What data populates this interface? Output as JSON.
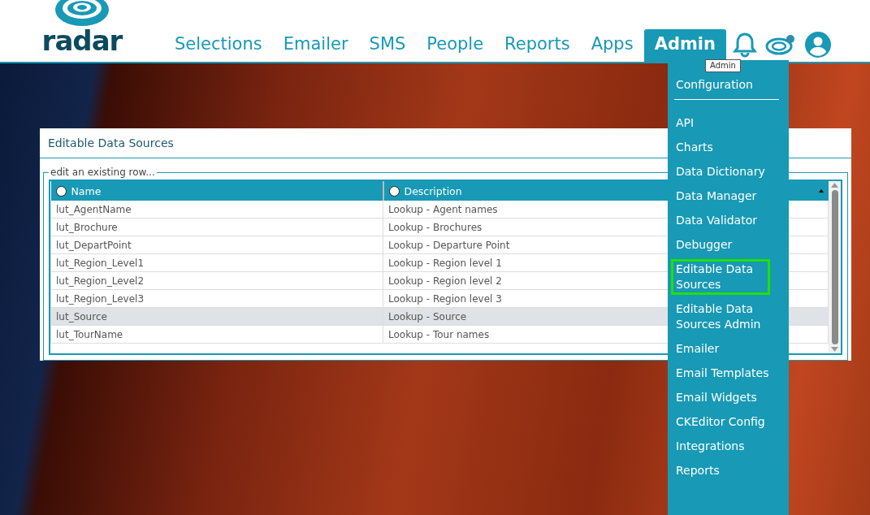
{
  "logo": {
    "text": "radar"
  },
  "nav": [
    {
      "label": "Selections",
      "selected": false
    },
    {
      "label": "Emailer",
      "selected": false
    },
    {
      "label": "SMS",
      "selected": false
    },
    {
      "label": "People",
      "selected": false
    },
    {
      "label": "Reports",
      "selected": false
    },
    {
      "label": "Apps",
      "selected": false
    },
    {
      "label": "Admin",
      "selected": true
    }
  ],
  "tooltip": "Admin",
  "panel": {
    "title": "Editable Data Sources",
    "legend": "edit an existing row...",
    "columns": [
      "Name",
      "Description"
    ],
    "rows": [
      {
        "cells": [
          "lut_AgentName",
          "Lookup - Agent names"
        ],
        "selected": false
      },
      {
        "cells": [
          "lut_Brochure",
          "Lookup - Brochures"
        ],
        "selected": false
      },
      {
        "cells": [
          "lut_DepartPoint",
          "Lookup - Departure Point"
        ],
        "selected": false
      },
      {
        "cells": [
          "lut_Region_Level1",
          "Lookup - Region level 1"
        ],
        "selected": false
      },
      {
        "cells": [
          "lut_Region_Level2",
          "Lookup - Region level 2"
        ],
        "selected": false
      },
      {
        "cells": [
          "lut_Region_Level3",
          "Lookup - Region level 3"
        ],
        "selected": false
      },
      {
        "cells": [
          "lut_Source",
          "Lookup - Source"
        ],
        "selected": true
      },
      {
        "cells": [
          "lut_TourName",
          "Lookup - Tour names"
        ],
        "selected": false
      }
    ]
  },
  "admin_menu": [
    {
      "label": "Configuration",
      "kind": "item",
      "selected": false
    },
    {
      "kind": "divider"
    },
    {
      "label": "API",
      "kind": "item",
      "selected": false
    },
    {
      "label": "Charts",
      "kind": "item",
      "selected": false
    },
    {
      "label": "Data Dictionary",
      "kind": "item",
      "selected": false
    },
    {
      "label": "Data Manager",
      "kind": "item",
      "selected": false
    },
    {
      "label": "Data Validator",
      "kind": "item",
      "selected": false
    },
    {
      "label": "Debugger",
      "kind": "item",
      "selected": false
    },
    {
      "label": "Editable Data Sources",
      "kind": "item",
      "selected": true
    },
    {
      "label": "Editable Data Sources Admin",
      "kind": "item",
      "selected": false
    },
    {
      "label": "Emailer",
      "kind": "item",
      "selected": false
    },
    {
      "label": "Email Templates",
      "kind": "item",
      "selected": false
    },
    {
      "label": "Email Widgets",
      "kind": "item",
      "selected": false
    },
    {
      "label": "CKEditor Config",
      "kind": "item",
      "selected": false
    },
    {
      "label": "Integrations",
      "kind": "item",
      "selected": false
    },
    {
      "label": "Reports",
      "kind": "item",
      "selected": false
    }
  ]
}
